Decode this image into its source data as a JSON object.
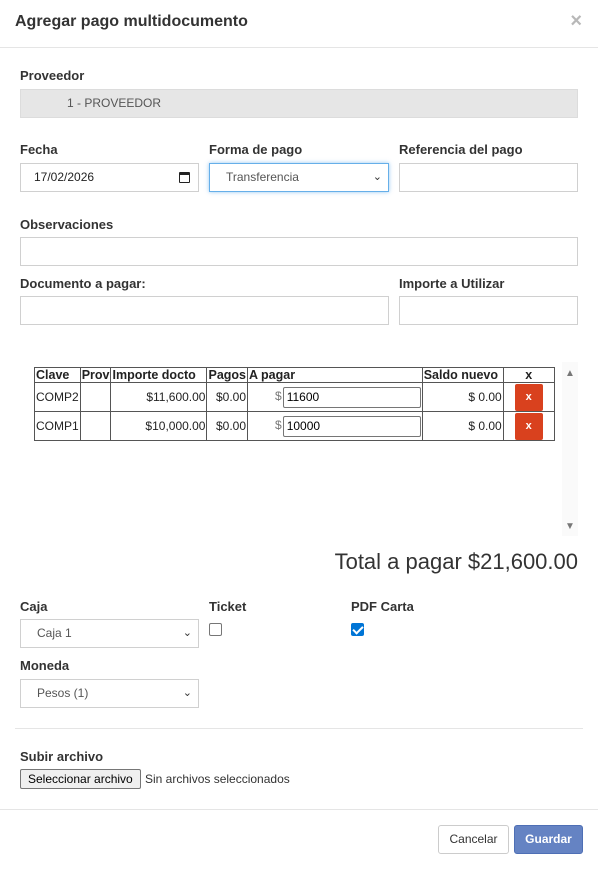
{
  "modal": {
    "title": "Agregar pago multidocumento",
    "close_glyph": "×"
  },
  "form": {
    "proveedor_label": "Proveedor",
    "proveedor_value": "1 - PROVEEDOR",
    "fecha_label": "Fecha",
    "fecha_value": "17/02/2026",
    "forma_pago_label": "Forma de pago",
    "forma_pago_value": "Transferencia",
    "referencia_label": "Referencia del pago",
    "referencia_value": "",
    "observaciones_label": "Observaciones",
    "observaciones_value": "",
    "documento_label": "Documento a pagar:",
    "documento_value": "",
    "importe_label": "Importe a Utilizar",
    "importe_value": ""
  },
  "table": {
    "headers": [
      "Clave",
      "Prov",
      "Importe docto",
      "Pagos",
      "A pagar",
      "Saldo nuevo",
      "x"
    ],
    "rows": [
      {
        "clave": "COMP2",
        "prov": "",
        "importe": "$11,600.00",
        "pagos": "$0.00",
        "currency": "$",
        "a_pagar": "11600",
        "saldo": "$ 0.00",
        "delete": "x"
      },
      {
        "clave": "COMP1",
        "prov": "",
        "importe": "$10,000.00",
        "pagos": "$0.00",
        "currency": "$",
        "a_pagar": "10000",
        "saldo": "$ 0.00",
        "delete": "x"
      }
    ]
  },
  "total": {
    "text": "Total a pagar $21,600.00"
  },
  "options": {
    "caja_label": "Caja",
    "caja_value": "Caja 1",
    "ticket_label": "Ticket",
    "ticket_checked": false,
    "pdf_label": "PDF Carta",
    "pdf_checked": true,
    "moneda_label": "Moneda",
    "moneda_value": "Pesos (1)"
  },
  "upload": {
    "label": "Subir archivo",
    "button_label": "Seleccionar archivo",
    "status": "Sin archivos seleccionados"
  },
  "footer": {
    "cancel_label": "Cancelar",
    "save_label": "Guardar"
  },
  "colors": {
    "save_button": "#6583c3",
    "delete_button": "#d9411e",
    "checkbox_checked": "#0075d6"
  }
}
